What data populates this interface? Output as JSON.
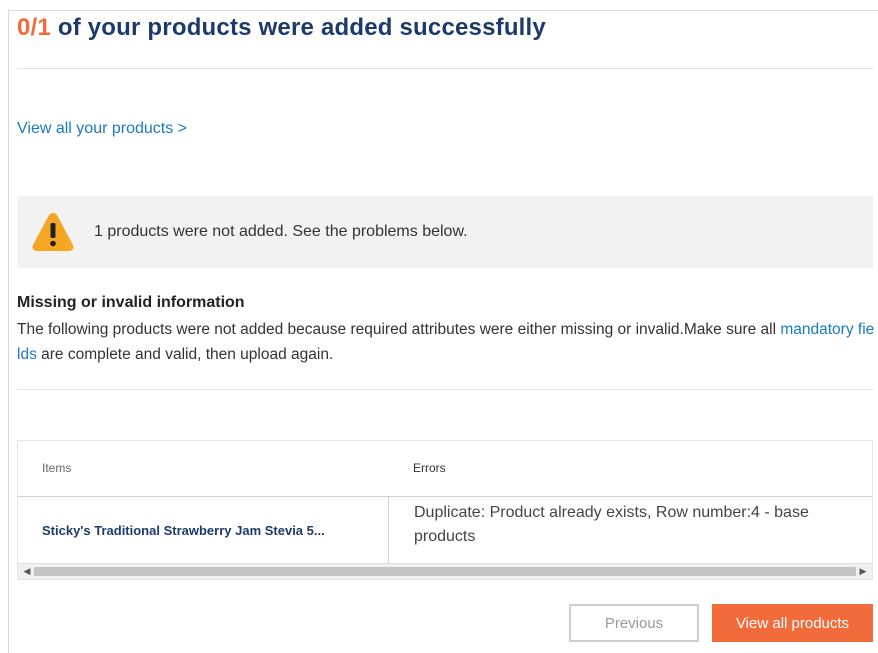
{
  "header": {
    "count": "0/1",
    "title_rest": " of your products were added successfully"
  },
  "links": {
    "view_all_products": "View all your products >"
  },
  "alert": {
    "icon": "warning-triangle-icon",
    "message": "1 products were not added. See the problems below."
  },
  "problems": {
    "title": "Missing or invalid information",
    "desc_before": "The following products were not added because required attributes were either missing or invalid.Make sure all ",
    "desc_link": "mandatory fields",
    "desc_after": " are complete and valid, then upload again."
  },
  "table": {
    "columns": [
      "Items",
      "Errors"
    ],
    "rows": [
      {
        "item": "Sticky's Traditional Strawberry Jam Stevia 5...",
        "error": "Duplicate: Product already exists, Row number:4 - base products"
      }
    ]
  },
  "buttons": {
    "previous": "Previous",
    "view_all": "View all products"
  },
  "colors": {
    "accent_orange": "#f26b3a",
    "title_navy": "#1d3a6b",
    "link_blue": "#1a7bbf",
    "warning_yellow": "#f5a623"
  }
}
